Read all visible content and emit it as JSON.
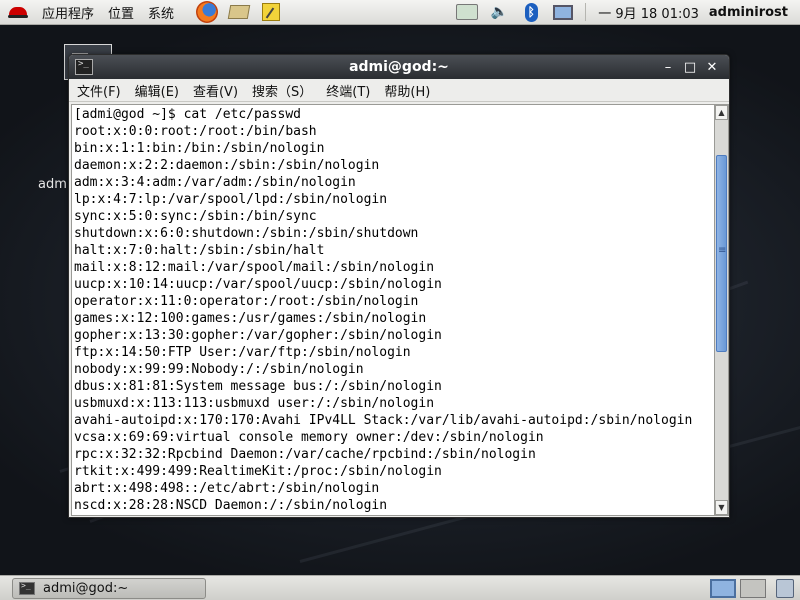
{
  "top_panel": {
    "menus": [
      "应用程序",
      "位置",
      "系统"
    ],
    "launchers": [
      "firefox-icon",
      "mail-icon",
      "notes-icon"
    ],
    "tray_icons": [
      "network-icon",
      "volume-icon",
      "bluetooth-icon",
      "display-icon"
    ],
    "clock": "一 9月 18 01:03",
    "user": "adminirost"
  },
  "desktop": {
    "icon_label": "admi"
  },
  "window": {
    "title": "admi@god:~",
    "controls": [
      "–",
      "□",
      "✕"
    ],
    "menu": [
      "文件(F)",
      "编辑(E)",
      "查看(V)",
      "搜索（S）",
      "终端(T)",
      "帮助(H)"
    ],
    "scrollbar": {
      "thumb_start": 0.09,
      "thumb_size": 0.52
    },
    "lines": [
      "[admi@god ~]$ cat /etc/passwd",
      "root:x:0:0:root:/root:/bin/bash",
      "bin:x:1:1:bin:/bin:/sbin/nologin",
      "daemon:x:2:2:daemon:/sbin:/sbin/nologin",
      "adm:x:3:4:adm:/var/adm:/sbin/nologin",
      "lp:x:4:7:lp:/var/spool/lpd:/sbin/nologin",
      "sync:x:5:0:sync:/sbin:/bin/sync",
      "shutdown:x:6:0:shutdown:/sbin:/sbin/shutdown",
      "halt:x:7:0:halt:/sbin:/sbin/halt",
      "mail:x:8:12:mail:/var/spool/mail:/sbin/nologin",
      "uucp:x:10:14:uucp:/var/spool/uucp:/sbin/nologin",
      "operator:x:11:0:operator:/root:/sbin/nologin",
      "games:x:12:100:games:/usr/games:/sbin/nologin",
      "gopher:x:13:30:gopher:/var/gopher:/sbin/nologin",
      "ftp:x:14:50:FTP User:/var/ftp:/sbin/nologin",
      "nobody:x:99:99:Nobody:/:/sbin/nologin",
      "dbus:x:81:81:System message bus:/:/sbin/nologin",
      "usbmuxd:x:113:113:usbmuxd user:/:/sbin/nologin",
      "avahi-autoipd:x:170:170:Avahi IPv4LL Stack:/var/lib/avahi-autoipd:/sbin/nologin",
      "vcsa:x:69:69:virtual console memory owner:/dev:/sbin/nologin",
      "rpc:x:32:32:Rpcbind Daemon:/var/cache/rpcbind:/sbin/nologin",
      "rtkit:x:499:499:RealtimeKit:/proc:/sbin/nologin",
      "abrt:x:498:498::/etc/abrt:/sbin/nologin",
      "nscd:x:28:28:NSCD Daemon:/:/sbin/nologin"
    ]
  },
  "taskbar": {
    "task_label": "admi@god:~",
    "workspaces": [
      "workspace-1",
      "workspace-2"
    ],
    "trash": "trash-icon"
  }
}
